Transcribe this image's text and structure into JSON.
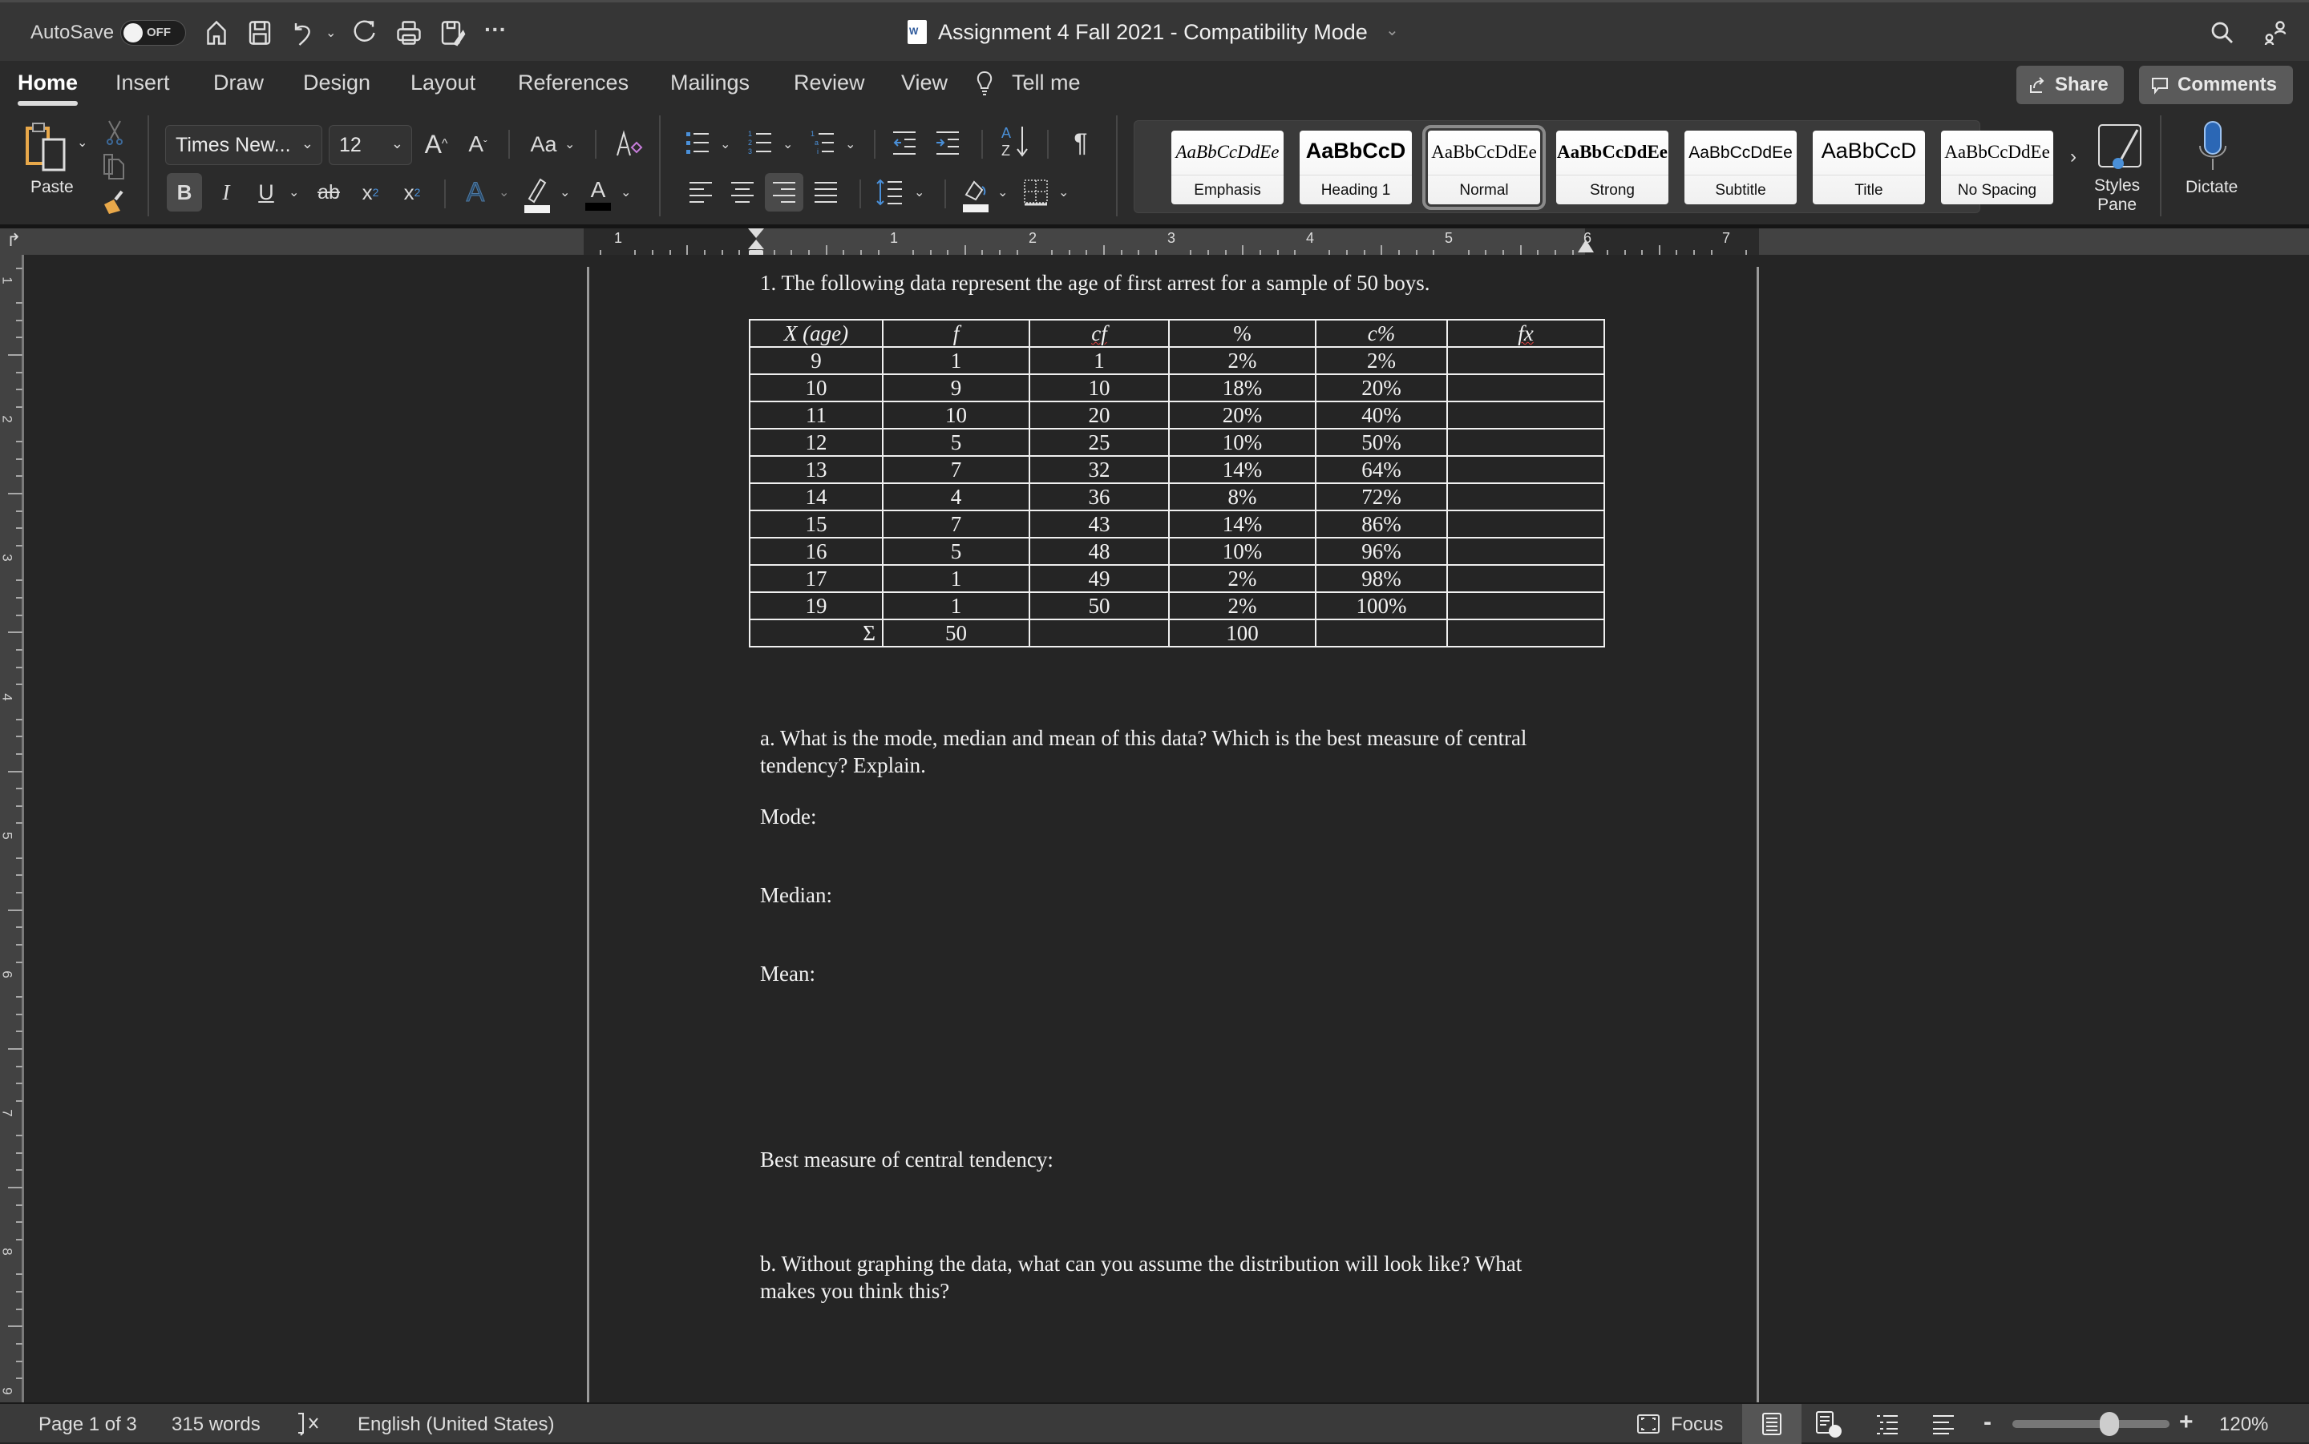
{
  "titlebar": {
    "autosave_label": "AutoSave",
    "autosave_state": "OFF",
    "doc_title": "Assignment 4 Fall 2021  -  Compatibility Mode",
    "quick_access_icons": [
      "home-icon",
      "save-icon",
      "undo-icon",
      "redo-icon",
      "print-icon",
      "save-as-icon",
      "more-icon"
    ]
  },
  "tabs": {
    "items": [
      "Home",
      "Insert",
      "Draw",
      "Design",
      "Layout",
      "References",
      "Mailings",
      "Review",
      "View"
    ],
    "active": "Home",
    "tell_me": "Tell me",
    "share": "Share",
    "comments": "Comments"
  },
  "ribbon": {
    "paste_label": "Paste",
    "font_name": "Times New...",
    "font_size": "12",
    "change_case": "Aa",
    "bold": "B",
    "italic": "I",
    "underline": "U",
    "strikethrough": "ab",
    "subscript": "x",
    "superscript": "x",
    "text_effects": "A",
    "font_color": "A",
    "styles": [
      {
        "sample": "AaBbCcDdEe",
        "name": "Emphasis"
      },
      {
        "sample": "AaBbCcD",
        "name": "Heading 1"
      },
      {
        "sample": "AaBbCcDdEe",
        "name": "Normal"
      },
      {
        "sample": "AaBbCcDdEe",
        "name": "Strong"
      },
      {
        "sample": "AaBbCcDdEe",
        "name": "Subtitle"
      },
      {
        "sample": "AaBbCcD",
        "name": "Title"
      },
      {
        "sample": "AaBbCcDdEe",
        "name": "No Spacing"
      }
    ],
    "active_style": "Normal",
    "styles_pane_line1": "Styles",
    "styles_pane_line2": "Pane",
    "dictate": "Dictate"
  },
  "ruler": {
    "h_numbers": [
      "1",
      "1",
      "2",
      "3",
      "4",
      "5",
      "6",
      "7"
    ],
    "v_numbers": [
      "1",
      "2",
      "3",
      "4",
      "5",
      "6",
      "7",
      "8",
      "9"
    ]
  },
  "document": {
    "intro": "1. The following data represent the age of first arrest for a sample of 50 boys.",
    "table": {
      "headers": [
        "X (age)",
        "f",
        "cf",
        "%",
        "c%",
        "fx"
      ],
      "rows": [
        [
          "9",
          "1",
          "1",
          "2%",
          "2%",
          ""
        ],
        [
          "10",
          "9",
          "10",
          "18%",
          "20%",
          ""
        ],
        [
          "11",
          "10",
          "20",
          "20%",
          "40%",
          ""
        ],
        [
          "12",
          "5",
          "25",
          "10%",
          "50%",
          ""
        ],
        [
          "13",
          "7",
          "32",
          "14%",
          "64%",
          ""
        ],
        [
          "14",
          "4",
          "36",
          "8%",
          "72%",
          ""
        ],
        [
          "15",
          "7",
          "43",
          "14%",
          "86%",
          ""
        ],
        [
          "16",
          "5",
          "48",
          "10%",
          "96%",
          ""
        ],
        [
          "17",
          "1",
          "49",
          "2%",
          "98%",
          ""
        ],
        [
          "19",
          "1",
          "50",
          "2%",
          "100%",
          ""
        ]
      ],
      "totals": [
        "Σ",
        "50",
        "",
        "100",
        "",
        ""
      ]
    },
    "question_a_line1": "a. What is the mode, median and mean of this data? Which is the best measure of central",
    "question_a_line2": "tendency? Explain.",
    "mode_label": "Mode:",
    "median_label": "Median:",
    "mean_label": "Mean:",
    "best_measure_label": "Best measure of central tendency:",
    "question_b_line1": "b. Without graphing the data, what can you assume the distribution will look like? What",
    "question_b_line2": "makes you think this?"
  },
  "statusbar": {
    "page": "Page 1 of 3",
    "words": "315 words",
    "language": "English (United States)",
    "focus": "Focus",
    "zoom": "120%",
    "zoom_level_percent": 120
  }
}
